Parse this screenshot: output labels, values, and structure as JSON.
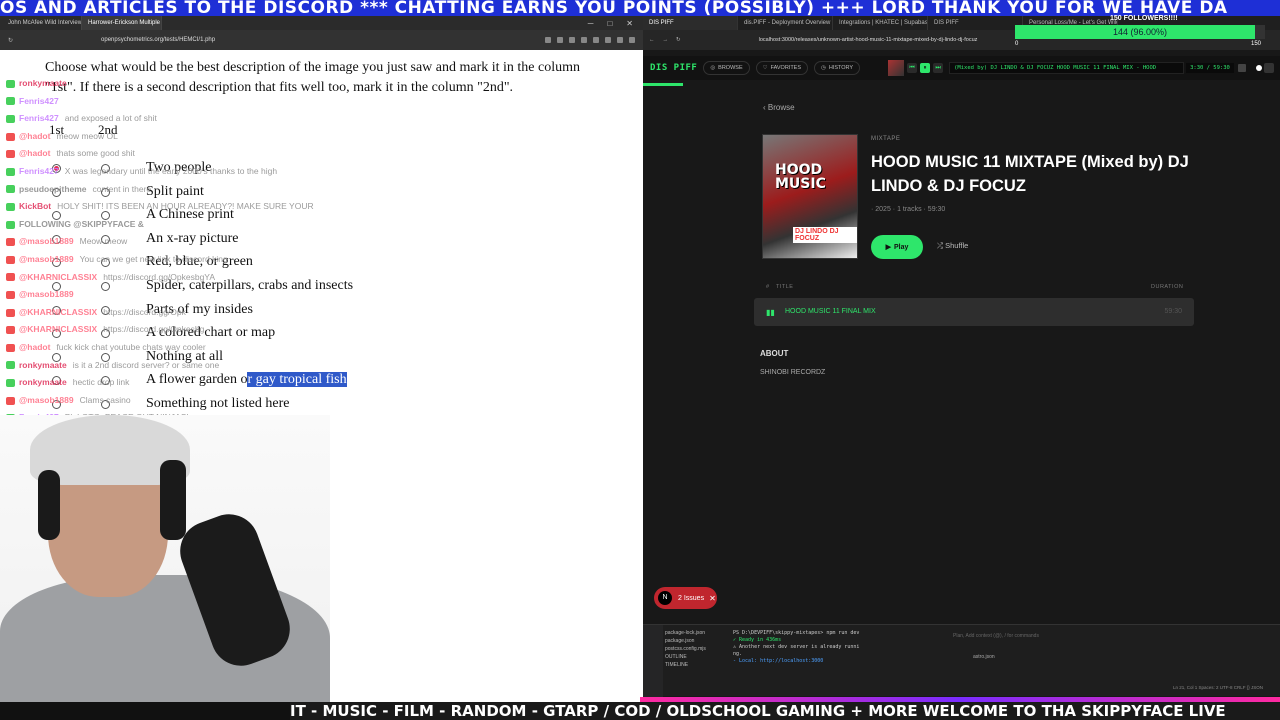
{
  "ticker_top": "OS AND ARTICLES TO THE DISCORD *** CHATTING EARNS YOU POINTS (POSSIBLY) +++ LORD THANK YOU FOR WE HAVE DA",
  "ticker_bottom": "IT - MUSIC - FILM - RANDOM - GTARP / COD / OLDSCHOOL GAMING + MORE WELCOME TO THA SKIPPYFACE LIVE",
  "left_browser": {
    "tabs": [
      "John McAfee Wild Interview - Y...",
      "Harrower-Erickson Multiple Ch..."
    ],
    "url": "openpsychometrics.org/tests/HEMCI/1.php"
  },
  "survey": {
    "question": "Choose what would be the best description of the image you just saw and mark it in the column \"1st\". If there is a second description that fits well too, mark it in the column \"2nd\".",
    "col1": "1st",
    "col2": "2nd",
    "options": [
      "Two people",
      "Split paint",
      "A Chinese print",
      "An x-ray picture",
      "Red, blue, or green",
      "Spider, caterpillars, crabs and insects",
      "Parts of my insides",
      "A colored chart or map",
      "Nothing at all",
      "A flower garden or gay tropical fish",
      "Something not listed here"
    ],
    "option_10_plain": "A flower garden o",
    "option_10_selected": "r gay tropical fish",
    "selected_1st_index": 0
  },
  "chat": [
    {
      "platform": "kick",
      "user": "ronkymaate",
      "msg": "",
      "color": "#e0305a"
    },
    {
      "platform": "kick",
      "user": "Fenris427",
      "msg": "",
      "color": "#c77dff"
    },
    {
      "platform": "kick",
      "user": "Fenris427",
      "msg": "and exposed a lot of shit",
      "color": "#c77dff"
    },
    {
      "platform": "youtube",
      "user": "@hadot",
      "msg": "meow meow OL",
      "color": "#ff6b81"
    },
    {
      "platform": "youtube",
      "user": "@hadot",
      "msg": "thats some good shit",
      "color": "#ff6b81"
    },
    {
      "platform": "kick",
      "user": "Fenris427",
      "msg": "X was legendary until the early 2000's thanks to the high",
      "color": "#c77dff"
    },
    {
      "platform": "kick",
      "user": "pseudoepitheme",
      "msg": "content in there",
      "color": "#888"
    },
    {
      "platform": "kick",
      "user": "KickBot",
      "msg": "HOLY SHIT! ITS BEEN AN HOUR ALREADY?! MAKE SURE YOUR",
      "color": "#e0305a"
    },
    {
      "platform": "kick",
      "user": "FOLLOWING @SKIPPYFACE &",
      "msg": "",
      "color": "#888"
    },
    {
      "platform": "youtube",
      "user": "@masob1889",
      "msg": "Meow meow",
      "color": "#ff6b81"
    },
    {
      "platform": "youtube",
      "user": "@masob1889",
      "msg": "You can we get new link to discord king",
      "color": "#ff6b81"
    },
    {
      "platform": "youtube",
      "user": "@KHARNICLASSIX",
      "msg": "https://discord.gg/OpkesbgYA",
      "color": "#ff6b81"
    },
    {
      "platform": "youtube",
      "user": "@masob1889",
      "msg": "",
      "color": "#ff6b81"
    },
    {
      "platform": "youtube",
      "user": "@KHARNICLASSIX",
      "msg": "https://discord.gg/Opk",
      "color": "#ff6b81"
    },
    {
      "platform": "youtube",
      "user": "@KHARNICLASSIX",
      "msg": "https://discord.gg/Opkesbg",
      "color": "#ff6b81"
    },
    {
      "platform": "youtube",
      "user": "@hadot",
      "msg": "fuck kick chat youtube chats way cooler",
      "color": "#ff6b81"
    },
    {
      "platform": "kick",
      "user": "ronkymaate",
      "msg": "is it a 2nd discord server? or same one",
      "color": "#e0305a"
    },
    {
      "platform": "kick",
      "user": "ronkymaate",
      "msg": "hectic drop link",
      "color": "#e0305a"
    },
    {
      "platform": "youtube",
      "user": "@masob1889",
      "msg": "Clams casino",
      "color": "#ff6b81"
    },
    {
      "platform": "kick",
      "user": "Fenris427",
      "msg": "Pk I GTG. PEACE OUT NINJAS!",
      "color": "#c77dff"
    }
  ],
  "right_browser": {
    "tabs": [
      "DIS PIFF",
      "dis.PIFF - Deployment Overview - Ve",
      "Integrations | KHATEC | Supabase",
      "DIS PIFF",
      "Personal Loss/Me - Let's Get Wild"
    ],
    "url": "localhost:3000/releases/unknown-artist-hood-music-11-mixtape-mixed-by-dj-lindo-dj-focuz"
  },
  "followers": {
    "title": "150 FOLLOWERS!!!!",
    "label": "144 (96.00%)",
    "fraction": 0.96,
    "min": "0",
    "max": "150"
  },
  "app": {
    "logo": "DIS PIFF",
    "nav": [
      "BROWSE",
      "FAVORITES",
      "HISTORY"
    ],
    "now_playing": "(Mixed by) DJ LINDO & DJ FOCUZ        HOOD MUSIC 11 FINAL MIX - HOOD",
    "time": "3:30 / 59:30",
    "browse_link": "Browse",
    "cover_title": "HOOD MUSIC",
    "cover_names": "DJ LINDO  DJ FOCUZ",
    "kind": "MIXTAPE",
    "title": "HOOD MUSIC 11 MIXTAPE (Mixed by) DJ LINDO & DJ FOCUZ",
    "meta": "· 2025 · 1 tracks · 59:30",
    "play": "Play",
    "shuffle": "Shuffle",
    "col_number": "#",
    "col_title": "TITLE",
    "col_duration": "DURATION",
    "track_name": "HOOD MUSIC 11 FINAL MIX",
    "track_duration": "59:30",
    "about_heading": "ABOUT",
    "about_text": "SHINOBI RECORDZ"
  },
  "issues": {
    "badge": "N",
    "label": "2 Issues"
  },
  "ide": {
    "files": [
      "package-lock.json",
      "package.json",
      "postcss.config.mjs",
      "OUTLINE",
      "TIMELINE"
    ],
    "terminal": [
      "PS D:\\DEVPIFF\\skippy-mixtapes> npm run dev",
      "✓ Ready in 436ms",
      "⚠ Another next dev server is already runni",
      "ng.",
      "- Local:        http://localhost:3000"
    ],
    "chat_hint": "Plan, Add context (@), / for commands",
    "chat_context": "astro.json",
    "status": "Ln 21, Col 1   Spaces: 2   UTF-8   CRLF   {} JSON"
  }
}
